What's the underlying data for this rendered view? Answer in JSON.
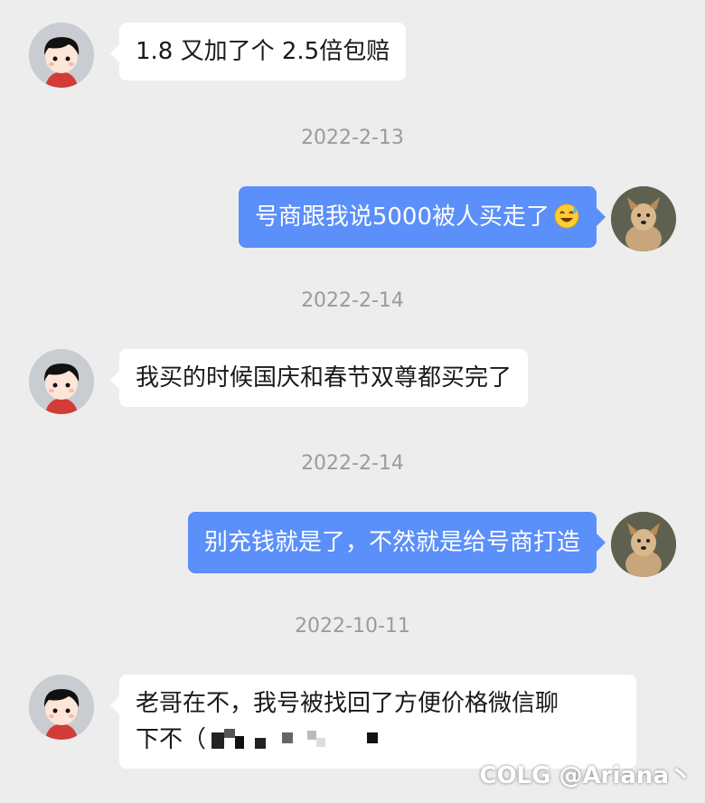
{
  "colors": {
    "background": "#ededed",
    "received_bubble": "#ffffff",
    "sent_bubble": "#5b8ff9",
    "timestamp": "#9b9b9b"
  },
  "messages": [
    {
      "side": "received",
      "text": "1.8 又加了个 2.5倍包赔"
    },
    {
      "timestamp": "2022-2-13"
    },
    {
      "side": "sent",
      "text": "号商跟我说5000被人买走了",
      "emoji": "sweat-smile-emoji"
    },
    {
      "timestamp": "2022-2-14"
    },
    {
      "side": "received",
      "text": "我买的时候国庆和春节双尊都买完了"
    },
    {
      "timestamp": "2022-2-14"
    },
    {
      "side": "sent",
      "text": "别充钱就是了，不然就是给号商打造"
    },
    {
      "timestamp": "2022-10-11"
    },
    {
      "side": "received",
      "line1": "老哥在不，我号被找回了方便价格微信聊",
      "line2": "下不（"
    }
  ],
  "watermark": {
    "logo": "COLG",
    "handle": "@Ariana丶"
  }
}
